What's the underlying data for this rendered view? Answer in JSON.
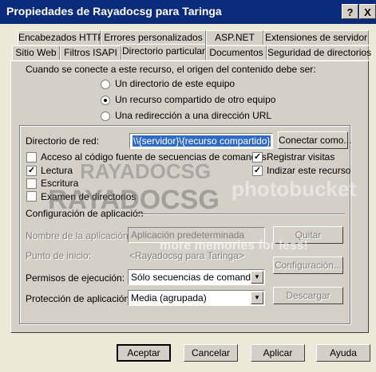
{
  "window": {
    "title": "Propiedades de Rayadocsg para Taringa",
    "help_btn": "?",
    "close_btn": "X"
  },
  "tabs_row1": [
    "Encabezados HTTP",
    "Errores personalizados",
    "ASP.NET",
    "Extensiones de servidor"
  ],
  "tabs_row2": [
    "Sitio Web",
    "Filtros ISAPI",
    "Directorio particular",
    "Documentos",
    "Seguridad de directorios"
  ],
  "source": {
    "prompt": "Cuando se conecte a este recurso, el origen del contenido debe ser:",
    "options": [
      "Un directorio de este equipo",
      "Un recurso compartido de otro equipo",
      "Una redirección a una dirección URL"
    ],
    "selected_index": 1
  },
  "network": {
    "label": "Directorio de red:",
    "value": "\\\\{servidor}\\{recurso compartido}",
    "connect_btn": "Conectar como..."
  },
  "permissions": {
    "script_source": {
      "label": "Acceso al código fuente de secuencias de comandos",
      "checked": false
    },
    "read": {
      "label": "Lectura",
      "checked": true
    },
    "write": {
      "label": "Escritura",
      "checked": false
    },
    "browse": {
      "label": "Examen de directorios",
      "checked": false
    },
    "log": {
      "label": "Registrar visitas",
      "checked": true
    },
    "index": {
      "label": "Indizar este recurso",
      "checked": true
    }
  },
  "app": {
    "section": "Configuración de aplicación",
    "name_label": "Nombre de la aplicación:",
    "name_value": "Aplicación predeterminada",
    "remove_btn": "Quitar",
    "start_label": "Punto de inicio:",
    "start_value": "<Rayadocsg para Taringa>",
    "config_btn": "Configuración...",
    "exec_label": "Permisos de ejecución:",
    "exec_value": "Sólo secuencias de comandos",
    "protect_label": "Protección de aplicación:",
    "protect_value": "Media (agrupada)",
    "unload_btn": "Descargar"
  },
  "footer": {
    "ok": "Aceptar",
    "cancel": "Cancelar",
    "apply": "Aplicar",
    "help": "Ayuda"
  },
  "watermarks": [
    "RAYADOCSG",
    "RAYADOCSG",
    "more memories for less!",
    "photobucket"
  ]
}
